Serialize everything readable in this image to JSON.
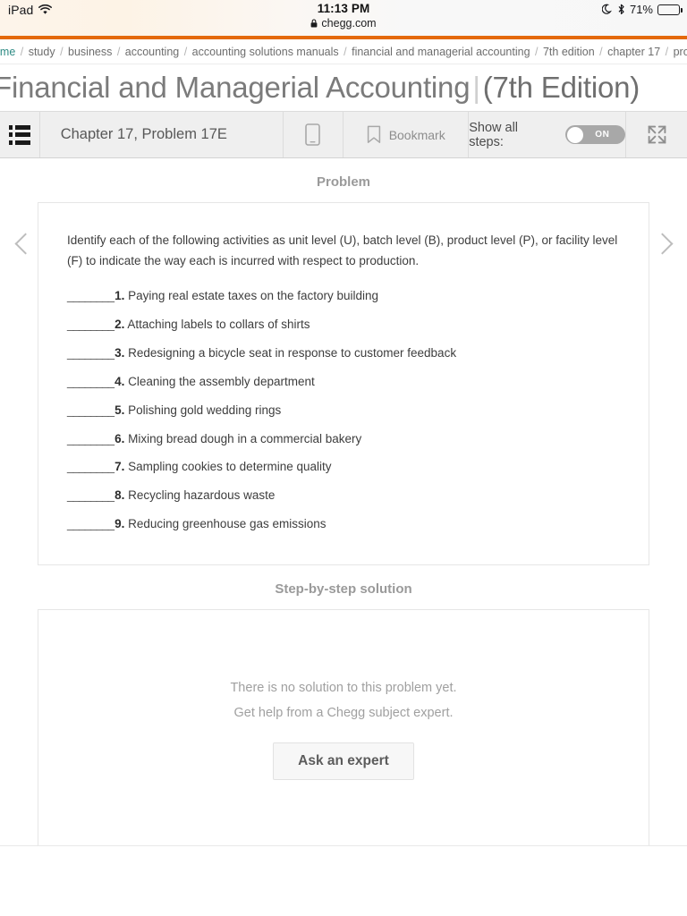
{
  "status_bar": {
    "device": "iPad",
    "wifi_icon": "wifi-icon",
    "time": "11:13 PM",
    "lock_icon": "lock-icon",
    "url": "chegg.com",
    "dnd_icon": "moon-icon",
    "bluetooth_icon": "bluetooth-icon",
    "battery_percent": "71%",
    "battery_icon": "battery-icon"
  },
  "breadcrumb": {
    "accent_color": "#e4690b",
    "home_color": "#2e8b84",
    "items": [
      "home",
      "study",
      "business",
      "accounting",
      "accounting solutions manuals",
      "financial and managerial accounting",
      "7th edition",
      "chapter 17",
      "problem"
    ]
  },
  "header": {
    "book_title": "Financial and Managerial Accounting",
    "edition": "(7th Edition)"
  },
  "toolbar": {
    "menu_icon": "list-icon",
    "chapter_label": "Chapter 17, Problem 17E",
    "mobile_icon": "mobile-device-icon",
    "bookmark_icon": "bookmark-icon",
    "bookmark_label": "Bookmark",
    "show_steps_label": "Show all steps:",
    "toggle_state": "ON",
    "expand_icon": "expand-arrows-icon"
  },
  "nav": {
    "prev_icon": "chevron-left-icon",
    "next_icon": "chevron-right-icon"
  },
  "problem": {
    "section_title": "Problem",
    "prompt": "Identify each of the following activities as unit level (U), batch level (B), product level (P), or facility level (F) to indicate the way each is incurred with respect to production.",
    "blank": "________",
    "items": [
      {
        "num": "1.",
        "text": "Paying real estate taxes on the factory building"
      },
      {
        "num": "2.",
        "text": "Attaching labels to collars of shirts"
      },
      {
        "num": "3.",
        "text": "Redesigning a bicycle seat in response to customer feedback"
      },
      {
        "num": "4.",
        "text": "Cleaning the assembly department"
      },
      {
        "num": "5.",
        "text": "Polishing gold wedding rings"
      },
      {
        "num": "6.",
        "text": "Mixing bread dough in a commercial bakery"
      },
      {
        "num": "7.",
        "text": "Sampling cookies to determine quality"
      },
      {
        "num": "8.",
        "text": "Recycling hazardous waste"
      },
      {
        "num": "9.",
        "text": "Reducing greenhouse gas emissions"
      }
    ]
  },
  "solution": {
    "section_title": "Step-by-step solution",
    "empty_line_1": "There is no solution to this problem yet.",
    "empty_line_2": "Get help from a Chegg subject expert.",
    "ask_button": "Ask an expert"
  }
}
